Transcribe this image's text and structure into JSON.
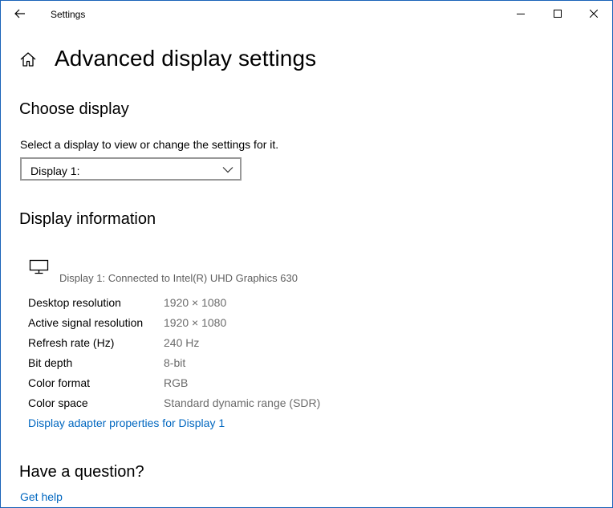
{
  "window": {
    "title": "Settings"
  },
  "page": {
    "title": "Advanced display settings"
  },
  "choose_display": {
    "heading": "Choose display",
    "description": "Select a display to view or change the settings for it.",
    "selected": "Display 1:"
  },
  "display_info": {
    "heading": "Display information",
    "display_name": "Display 1: Connected to Intel(R) UHD Graphics 630",
    "rows": [
      {
        "label": "Desktop resolution",
        "value": "1920 × 1080"
      },
      {
        "label": "Active signal resolution",
        "value": "1920 × 1080"
      },
      {
        "label": "Refresh rate (Hz)",
        "value": "240 Hz"
      },
      {
        "label": "Bit depth",
        "value": "8-bit"
      },
      {
        "label": "Color format",
        "value": "RGB"
      },
      {
        "label": "Color space",
        "value": "Standard dynamic range (SDR)"
      }
    ],
    "adapter_link": "Display adapter properties for Display 1"
  },
  "help": {
    "heading": "Have a question?",
    "link": "Get help"
  },
  "icons": [
    "back-arrow-icon",
    "minimize-icon",
    "maximize-icon",
    "close-icon",
    "home-icon",
    "chevron-down-icon",
    "monitor-icon"
  ],
  "colors": {
    "accent_link": "#0067c0",
    "window_border": "#1a63b8",
    "value_text": "#6b6b6b"
  }
}
